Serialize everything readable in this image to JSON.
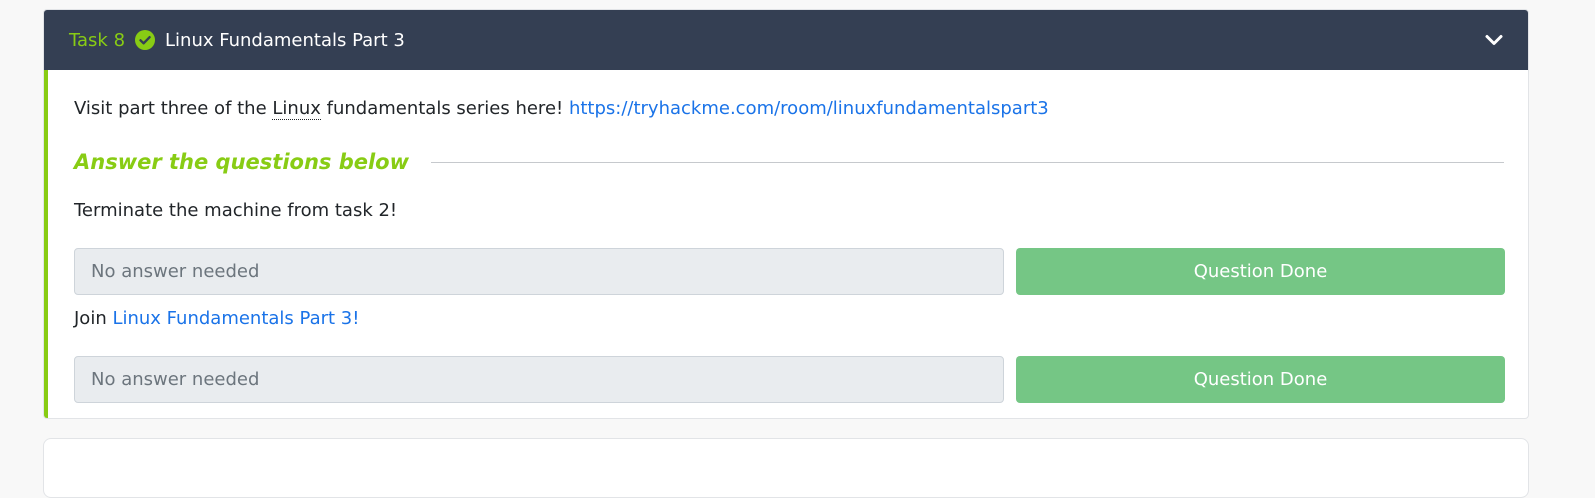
{
  "task": {
    "number_label": "Task 8",
    "title": "Linux Fundamentals Part 3",
    "status_icon": "check-circle-icon",
    "toggle_icon": "chevron-down-icon",
    "intro": {
      "prefix": "Visit part three of the ",
      "abbr_word": "Linux",
      "middle": " fundamentals series here! ",
      "link_text": "https://tryhackme.com/room/linuxfundamentalspart3"
    },
    "answer_heading": "Answer the questions below",
    "questions": [
      {
        "text": "Terminate the machine from task 2!",
        "placeholder": "No answer needed",
        "button_label": "Question Done"
      },
      {
        "text_prefix": "Join ",
        "link_text": "Linux Fundamentals Part 3!",
        "placeholder": "No answer needed",
        "button_label": "Question Done"
      }
    ]
  },
  "colors": {
    "accent_green": "#88cc14",
    "header_bg": "#343f53",
    "done_button": "#75c685",
    "link_blue": "#1a73e8"
  }
}
